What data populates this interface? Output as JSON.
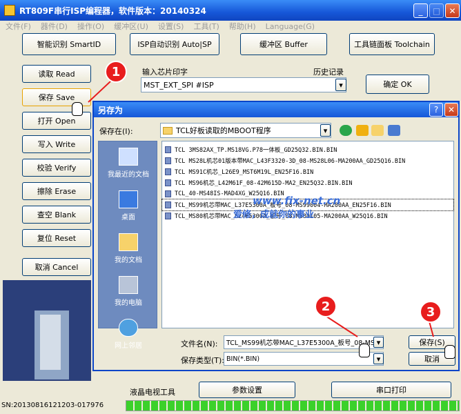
{
  "window": {
    "title": "RT809F串行ISP编程器，软件版本：20140324"
  },
  "menu": [
    "文件(F)",
    "器件(D)",
    "操作(O)",
    "缓冲区(U)",
    "设置(S)",
    "工具(T)",
    "帮助(H)",
    "Language(G)"
  ],
  "toolbar": {
    "smartid": "智能识别 SmartID",
    "autoisp": "ISP自动识别 Auto|SP",
    "buffer": "缓冲区 Buffer",
    "toolchain": "工具链面板 Toolchain"
  },
  "side": {
    "read": "读取 Read",
    "save": "保存 Save",
    "open": "打开 Open",
    "write": "写入 Write",
    "verify": "校验 Verify",
    "erase": "擦除 Erase",
    "blank": "查空 Blank",
    "reset": "复位 Reset",
    "cancel": "取消 Cancel"
  },
  "chip": {
    "label": "输入芯片印字",
    "value": "MST_EXT_SPI #ISP",
    "history": "历史记录",
    "ok": "确定 OK"
  },
  "dialog": {
    "title": "另存为",
    "savein_label": "保存在(I):",
    "savein_value": "TCL好板读取的MBOOT程序",
    "places": [
      "我最近的文档",
      "桌面",
      "我的文档",
      "我的电脑",
      "网上邻居"
    ],
    "files": [
      "TCL 3MS82AX_TP.MS18VG.P78一体板_GD25Q32.BIN.BIN",
      "TCL MS28L机芯01版本带MAC_L43F3320-3D_08-MS28L06-MA200AA_GD25Q16.BIN",
      "TCL MS91C机芯_L26E9_MST6M19L_EN25F16.BIN",
      "TCL MS96机芯_L42M61F_08-42M615D-MA2_EN25Q32.BIN.BIN",
      "TCL_40-MS48IS-MAD4XG_W25Q16.BIN",
      "TCL_MS99机芯带MAC_L37E5300A_板号_08-MS99004-MA200AA_EN25F16.BIN",
      "TCL_MS80机芯带MAC_L24E5300A_板号_08-MS80105-MA200AA_W25Q16.BIN"
    ],
    "watermark_url": "www.fix-net.cn",
    "watermark_text": "爱修，成就你的事业",
    "filename_label": "文件名(N):",
    "filename_value": "TCL_MS99机芯带MAC_L37E5300A_板号_08-MS",
    "filetype_label": "保存类型(T):",
    "filetype_value": "BIN(*.BIN)",
    "save_btn": "保存(S)",
    "cancel_btn": "取消"
  },
  "bottom": {
    "lcd_tool": "液晶电视工具",
    "params": "参数设置",
    "serial": "串口打印",
    "sn": "SN:20130816121203-017976"
  },
  "callouts": [
    "1",
    "2",
    "3"
  ],
  "colors": {
    "accent": "#0a45c8",
    "callout": "#e81d1d",
    "progress": "#3bd12a"
  }
}
